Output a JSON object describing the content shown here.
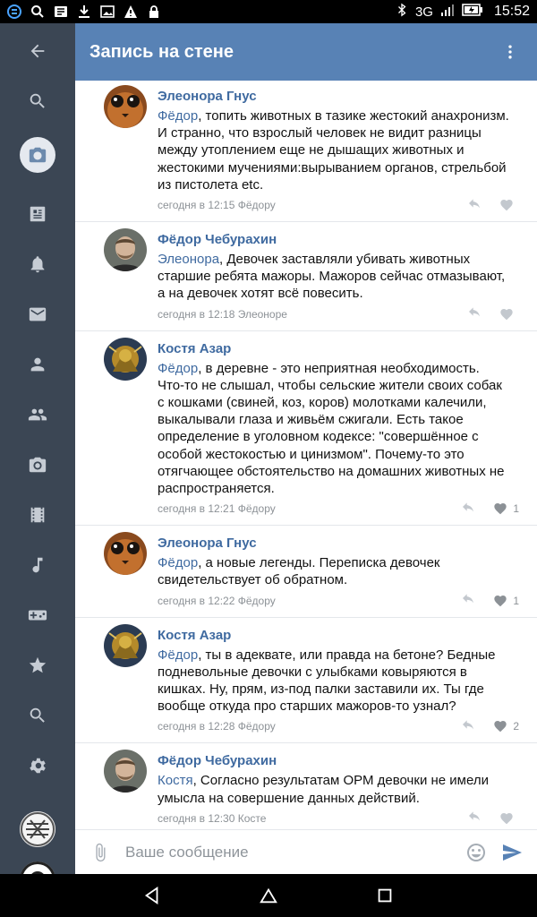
{
  "status_bar": {
    "network": "3G",
    "time": "15:52",
    "icons": [
      "app-icon",
      "search-icon",
      "news-icon",
      "download-icon",
      "image-icon",
      "warning-icon",
      "lock-icon",
      "bluetooth-icon",
      "signal-icon",
      "battery-icon"
    ]
  },
  "header": {
    "title": "Запись на стене",
    "menu_icon": "more-vertical-icon"
  },
  "sidebar": {
    "items": [
      {
        "icon": "back-arrow-icon"
      },
      {
        "icon": "search-icon"
      },
      {
        "icon": "camera-icon",
        "active": true
      },
      {
        "icon": "news-icon"
      },
      {
        "icon": "bell-icon"
      },
      {
        "icon": "mail-icon"
      },
      {
        "icon": "person-icon"
      },
      {
        "icon": "group-icon"
      },
      {
        "icon": "photo-icon"
      },
      {
        "icon": "video-icon"
      },
      {
        "icon": "music-icon"
      },
      {
        "icon": "game-icon"
      },
      {
        "icon": "star-icon"
      },
      {
        "icon": "search-icon"
      },
      {
        "icon": "gear-icon"
      }
    ]
  },
  "comments": [
    {
      "author": "Элеонора Гнус",
      "reply_to": "Фёдор",
      "text": ", топить животных в тазике жестокий анахронизм. И странно, что взрослый человек не видит разницы между утоплением еще не дышащих животных и жестокими мучениями:вырыванием органов, стрельбой из пистолета etc.",
      "time": "сегодня в 12:15 Фёдору",
      "likes": ""
    },
    {
      "author": "Фёдор Чебурахин",
      "reply_to": "Элеонора",
      "text": ", Девочек заставляли убивать животных старшие ребята мажоры. Мажоров сейчас отмазывают, а на девочек хотят всё повесить.",
      "time": "сегодня в 12:18 Элеоноре",
      "likes": ""
    },
    {
      "author": "Костя Азар",
      "reply_to": "Фёдор",
      "text": ", в деревне - это неприятная необходимость. Что-то не слышал, чтобы сельские жители своих собак с кошками (свиней, коз, коров) молотками калечили, выкалывали глаза и живьём сжигали. Есть такое определение в уголовном кодексе: \"совершённое с особой жестокостью и цинизмом\". Почему-то это отягчающее обстоятельство на домашних животных не распространяется.",
      "time": "сегодня в 12:21 Фёдору",
      "likes": "1"
    },
    {
      "author": "Элеонора Гнус",
      "reply_to": "Фёдор",
      "text": ", а новые легенды. Переписка девочек свидетельствует об обратном.",
      "time": "сегодня в 12:22 Фёдору",
      "likes": "1"
    },
    {
      "author": "Костя Азар",
      "reply_to": "Фёдор",
      "text": ", ты в адеквате, или правда на бетоне? Бедные подневольные девочки с улыбками ковыряются в кишках. Ну, прям, из-под палки заставили их. Ты где вообще откуда про старших мажоров-то узнал?",
      "time": "сегодня в 12:28 Фёдору",
      "likes": "2"
    },
    {
      "author": "Фёдор Чебурахин",
      "reply_to": "Костя",
      "text": ", Согласно результатам ОРМ девочки не имели умысла на совершение данных действий.",
      "time": "сегодня в 12:30 Косте",
      "likes": ""
    }
  ],
  "composer": {
    "placeholder": "Ваше сообщение"
  },
  "colors": {
    "header": "#5882b5",
    "sidebar": "#3b4654",
    "link": "#3f6aa0"
  }
}
